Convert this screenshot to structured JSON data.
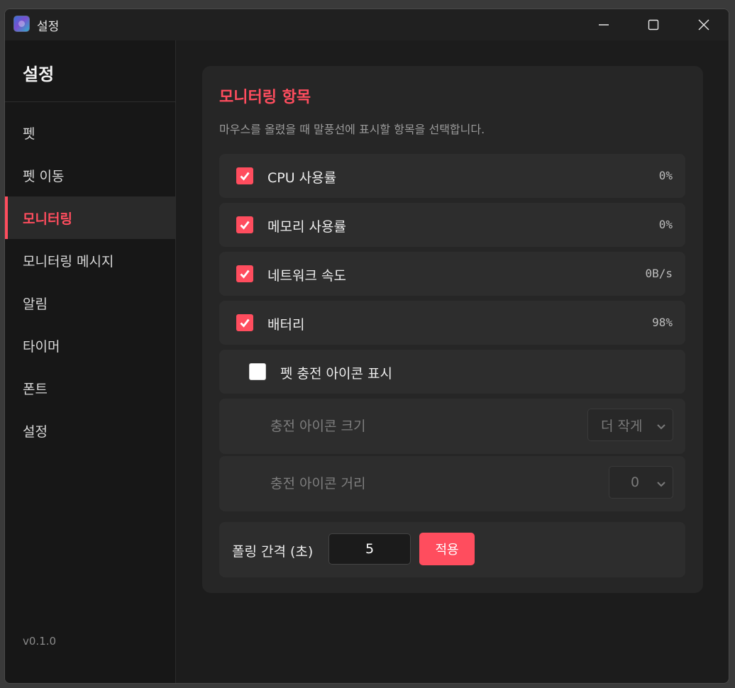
{
  "window": {
    "title": "설정"
  },
  "sidebar": {
    "title": "설정",
    "items": [
      {
        "label": "펫",
        "active": false
      },
      {
        "label": "펫 이동",
        "active": false
      },
      {
        "label": "모니터링",
        "active": true
      },
      {
        "label": "모니터링 메시지",
        "active": false
      },
      {
        "label": "알림",
        "active": false
      },
      {
        "label": "타이머",
        "active": false
      },
      {
        "label": "폰트",
        "active": false
      },
      {
        "label": "설정",
        "active": false
      }
    ],
    "version": "v0.1.0"
  },
  "main": {
    "title": "모니터링 항목",
    "description": "마우스를 올렸을 때 말풍선에 표시할 항목을 선택합니다.",
    "items": [
      {
        "label": "CPU 사용률",
        "checked": true,
        "value": "0%"
      },
      {
        "label": "메모리 사용률",
        "checked": true,
        "value": "0%"
      },
      {
        "label": "네트워크 속도",
        "checked": true,
        "value": "0B/s"
      },
      {
        "label": "배터리",
        "checked": true,
        "value": "98%"
      }
    ],
    "charge_icon": {
      "label": "펫 충전 아이콘 표시",
      "checked": false
    },
    "icon_size": {
      "label": "충전 아이콘 크기",
      "selected": "더 작게"
    },
    "icon_distance": {
      "label": "충전 아이콘 거리",
      "selected": "0"
    },
    "interval": {
      "label": "폴링 간격 (초)",
      "value": "5",
      "apply_label": "적용"
    }
  },
  "colors": {
    "accent": "#ff4d5e",
    "background": "#1c1c1c",
    "card": "#262626",
    "row": "#2d2d2d"
  }
}
